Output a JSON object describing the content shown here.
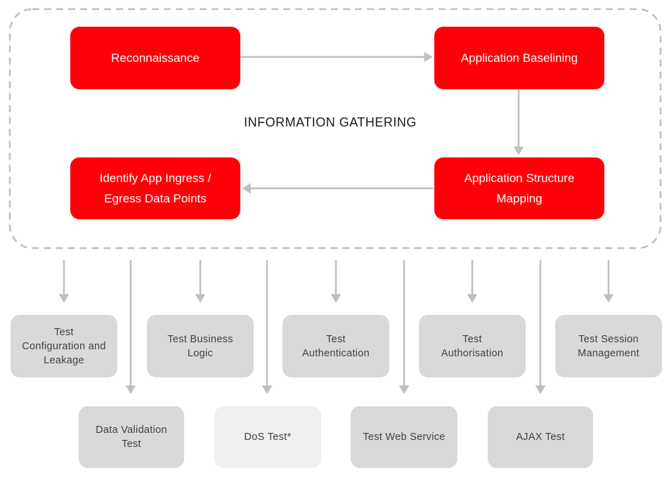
{
  "diagram": {
    "group_label": "INFORMATION GATHERING",
    "colors": {
      "phase_fill": "#ff0009",
      "phase_text": "#ffffff",
      "test_fill": "#d9d9d9",
      "optional_test_fill": "#f0f0f0",
      "test_text": "#404040",
      "connector": "#bfbfbf",
      "group_border": "#bfbfbf"
    },
    "phases": [
      {
        "id": "reconnaissance",
        "lines": [
          "Reconnaissance"
        ]
      },
      {
        "id": "application-baselining",
        "lines": [
          "Application Baselining"
        ]
      },
      {
        "id": "application-structure-mapping",
        "lines": [
          "Application Structure",
          "Mapping"
        ]
      },
      {
        "id": "identify-ingress-egress",
        "lines": [
          "Identify App Ingress /",
          "Egress Data Points"
        ]
      }
    ],
    "phase_flow": [
      {
        "from": "reconnaissance",
        "to": "application-baselining"
      },
      {
        "from": "application-baselining",
        "to": "application-structure-mapping"
      },
      {
        "from": "application-structure-mapping",
        "to": "identify-ingress-egress"
      }
    ],
    "tests_top_row": [
      {
        "id": "test-configuration-and-leakage",
        "label": "Test\nConfiguration and\nLeakage"
      },
      {
        "id": "test-business-logic",
        "label": "Test Business\nLogic"
      },
      {
        "id": "test-authentication",
        "label": "Test\nAuthentication"
      },
      {
        "id": "test-authorisation",
        "label": "Test\nAuthorisation"
      },
      {
        "id": "test-session-management",
        "label": "Test Session\nManagement"
      }
    ],
    "tests_bottom_row": [
      {
        "id": "data-validation-test",
        "label": "Data Validation\nTest",
        "optional": false
      },
      {
        "id": "dos-test",
        "label": "DoS Test*",
        "optional": true
      },
      {
        "id": "test-web-service",
        "label": "Test Web Service",
        "optional": false
      },
      {
        "id": "ajax-test",
        "label": "AJAX Test",
        "optional": false
      }
    ]
  }
}
